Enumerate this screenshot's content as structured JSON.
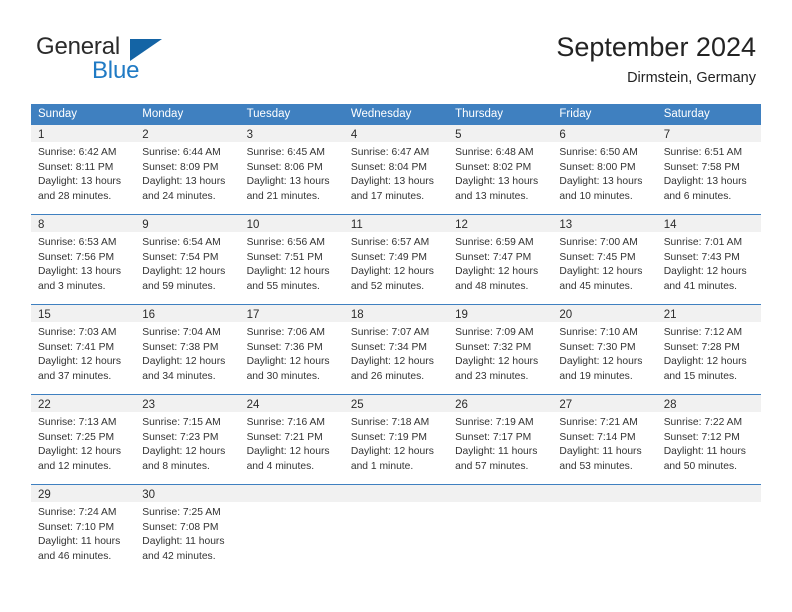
{
  "brand": {
    "name_part1": "General",
    "name_part2": "Blue",
    "triangle_icon": "logo-triangle-icon",
    "colors": {
      "general": "#2b2b2b",
      "blue": "#1f7ac4",
      "triangle": "#1464a5"
    }
  },
  "header": {
    "title": "September 2024",
    "subtitle": "Dirmstein, Germany"
  },
  "theme": {
    "header_bg": "#3f80c0",
    "header_text": "#ffffff",
    "day_band_bg": "#f1f1f1",
    "cell_bg": "#ffffff",
    "row_divider": "#3f80c0",
    "body_text": "#333333"
  },
  "weekdays": [
    "Sunday",
    "Monday",
    "Tuesday",
    "Wednesday",
    "Thursday",
    "Friday",
    "Saturday"
  ],
  "weeks": [
    [
      {
        "day": "1",
        "sunrise": "Sunrise: 6:42 AM",
        "sunset": "Sunset: 8:11 PM",
        "daylight1": "Daylight: 13 hours",
        "daylight2": "and 28 minutes."
      },
      {
        "day": "2",
        "sunrise": "Sunrise: 6:44 AM",
        "sunset": "Sunset: 8:09 PM",
        "daylight1": "Daylight: 13 hours",
        "daylight2": "and 24 minutes."
      },
      {
        "day": "3",
        "sunrise": "Sunrise: 6:45 AM",
        "sunset": "Sunset: 8:06 PM",
        "daylight1": "Daylight: 13 hours",
        "daylight2": "and 21 minutes."
      },
      {
        "day": "4",
        "sunrise": "Sunrise: 6:47 AM",
        "sunset": "Sunset: 8:04 PM",
        "daylight1": "Daylight: 13 hours",
        "daylight2": "and 17 minutes."
      },
      {
        "day": "5",
        "sunrise": "Sunrise: 6:48 AM",
        "sunset": "Sunset: 8:02 PM",
        "daylight1": "Daylight: 13 hours",
        "daylight2": "and 13 minutes."
      },
      {
        "day": "6",
        "sunrise": "Sunrise: 6:50 AM",
        "sunset": "Sunset: 8:00 PM",
        "daylight1": "Daylight: 13 hours",
        "daylight2": "and 10 minutes."
      },
      {
        "day": "7",
        "sunrise": "Sunrise: 6:51 AM",
        "sunset": "Sunset: 7:58 PM",
        "daylight1": "Daylight: 13 hours",
        "daylight2": "and 6 minutes."
      }
    ],
    [
      {
        "day": "8",
        "sunrise": "Sunrise: 6:53 AM",
        "sunset": "Sunset: 7:56 PM",
        "daylight1": "Daylight: 13 hours",
        "daylight2": "and 3 minutes."
      },
      {
        "day": "9",
        "sunrise": "Sunrise: 6:54 AM",
        "sunset": "Sunset: 7:54 PM",
        "daylight1": "Daylight: 12 hours",
        "daylight2": "and 59 minutes."
      },
      {
        "day": "10",
        "sunrise": "Sunrise: 6:56 AM",
        "sunset": "Sunset: 7:51 PM",
        "daylight1": "Daylight: 12 hours",
        "daylight2": "and 55 minutes."
      },
      {
        "day": "11",
        "sunrise": "Sunrise: 6:57 AM",
        "sunset": "Sunset: 7:49 PM",
        "daylight1": "Daylight: 12 hours",
        "daylight2": "and 52 minutes."
      },
      {
        "day": "12",
        "sunrise": "Sunrise: 6:59 AM",
        "sunset": "Sunset: 7:47 PM",
        "daylight1": "Daylight: 12 hours",
        "daylight2": "and 48 minutes."
      },
      {
        "day": "13",
        "sunrise": "Sunrise: 7:00 AM",
        "sunset": "Sunset: 7:45 PM",
        "daylight1": "Daylight: 12 hours",
        "daylight2": "and 45 minutes."
      },
      {
        "day": "14",
        "sunrise": "Sunrise: 7:01 AM",
        "sunset": "Sunset: 7:43 PM",
        "daylight1": "Daylight: 12 hours",
        "daylight2": "and 41 minutes."
      }
    ],
    [
      {
        "day": "15",
        "sunrise": "Sunrise: 7:03 AM",
        "sunset": "Sunset: 7:41 PM",
        "daylight1": "Daylight: 12 hours",
        "daylight2": "and 37 minutes."
      },
      {
        "day": "16",
        "sunrise": "Sunrise: 7:04 AM",
        "sunset": "Sunset: 7:38 PM",
        "daylight1": "Daylight: 12 hours",
        "daylight2": "and 34 minutes."
      },
      {
        "day": "17",
        "sunrise": "Sunrise: 7:06 AM",
        "sunset": "Sunset: 7:36 PM",
        "daylight1": "Daylight: 12 hours",
        "daylight2": "and 30 minutes."
      },
      {
        "day": "18",
        "sunrise": "Sunrise: 7:07 AM",
        "sunset": "Sunset: 7:34 PM",
        "daylight1": "Daylight: 12 hours",
        "daylight2": "and 26 minutes."
      },
      {
        "day": "19",
        "sunrise": "Sunrise: 7:09 AM",
        "sunset": "Sunset: 7:32 PM",
        "daylight1": "Daylight: 12 hours",
        "daylight2": "and 23 minutes."
      },
      {
        "day": "20",
        "sunrise": "Sunrise: 7:10 AM",
        "sunset": "Sunset: 7:30 PM",
        "daylight1": "Daylight: 12 hours",
        "daylight2": "and 19 minutes."
      },
      {
        "day": "21",
        "sunrise": "Sunrise: 7:12 AM",
        "sunset": "Sunset: 7:28 PM",
        "daylight1": "Daylight: 12 hours",
        "daylight2": "and 15 minutes."
      }
    ],
    [
      {
        "day": "22",
        "sunrise": "Sunrise: 7:13 AM",
        "sunset": "Sunset: 7:25 PM",
        "daylight1": "Daylight: 12 hours",
        "daylight2": "and 12 minutes."
      },
      {
        "day": "23",
        "sunrise": "Sunrise: 7:15 AM",
        "sunset": "Sunset: 7:23 PM",
        "daylight1": "Daylight: 12 hours",
        "daylight2": "and 8 minutes."
      },
      {
        "day": "24",
        "sunrise": "Sunrise: 7:16 AM",
        "sunset": "Sunset: 7:21 PM",
        "daylight1": "Daylight: 12 hours",
        "daylight2": "and 4 minutes."
      },
      {
        "day": "25",
        "sunrise": "Sunrise: 7:18 AM",
        "sunset": "Sunset: 7:19 PM",
        "daylight1": "Daylight: 12 hours",
        "daylight2": "and 1 minute."
      },
      {
        "day": "26",
        "sunrise": "Sunrise: 7:19 AM",
        "sunset": "Sunset: 7:17 PM",
        "daylight1": "Daylight: 11 hours",
        "daylight2": "and 57 minutes."
      },
      {
        "day": "27",
        "sunrise": "Sunrise: 7:21 AM",
        "sunset": "Sunset: 7:14 PM",
        "daylight1": "Daylight: 11 hours",
        "daylight2": "and 53 minutes."
      },
      {
        "day": "28",
        "sunrise": "Sunrise: 7:22 AM",
        "sunset": "Sunset: 7:12 PM",
        "daylight1": "Daylight: 11 hours",
        "daylight2": "and 50 minutes."
      }
    ],
    [
      {
        "day": "29",
        "sunrise": "Sunrise: 7:24 AM",
        "sunset": "Sunset: 7:10 PM",
        "daylight1": "Daylight: 11 hours",
        "daylight2": "and 46 minutes."
      },
      {
        "day": "30",
        "sunrise": "Sunrise: 7:25 AM",
        "sunset": "Sunset: 7:08 PM",
        "daylight1": "Daylight: 11 hours",
        "daylight2": "and 42 minutes."
      },
      {
        "day": "",
        "sunrise": "",
        "sunset": "",
        "daylight1": "",
        "daylight2": ""
      },
      {
        "day": "",
        "sunrise": "",
        "sunset": "",
        "daylight1": "",
        "daylight2": ""
      },
      {
        "day": "",
        "sunrise": "",
        "sunset": "",
        "daylight1": "",
        "daylight2": ""
      },
      {
        "day": "",
        "sunrise": "",
        "sunset": "",
        "daylight1": "",
        "daylight2": ""
      },
      {
        "day": "",
        "sunrise": "",
        "sunset": "",
        "daylight1": "",
        "daylight2": ""
      }
    ]
  ]
}
